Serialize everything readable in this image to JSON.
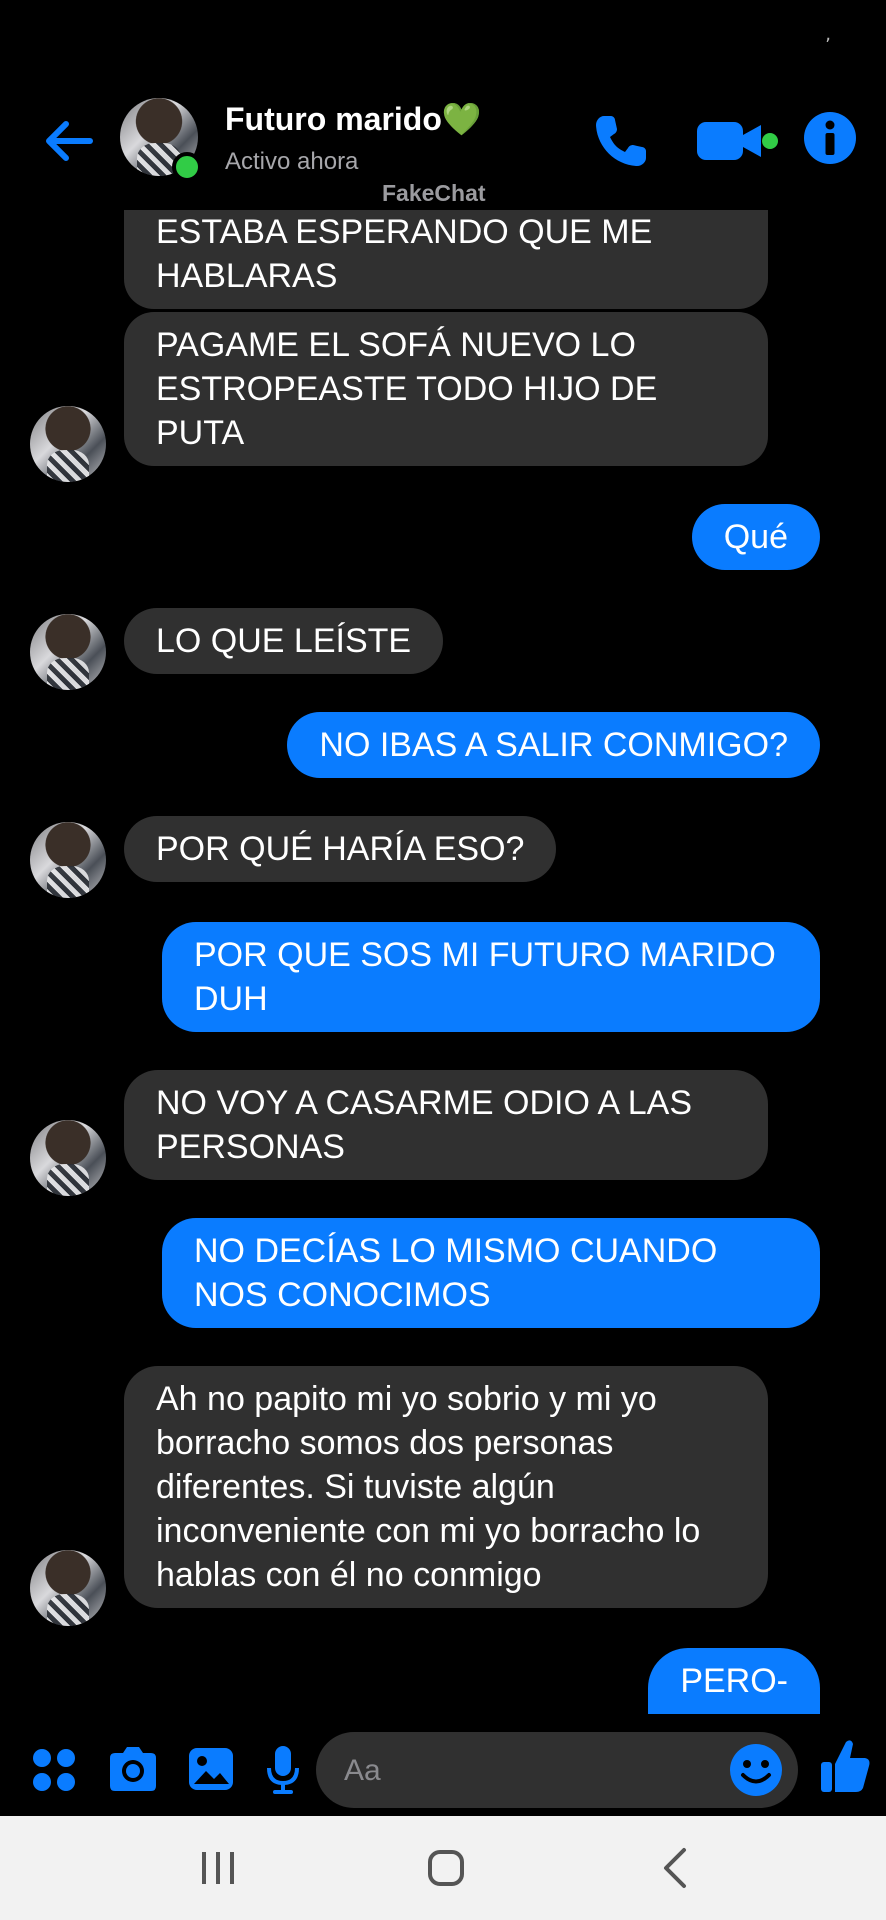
{
  "status_bar": {
    "mark": ","
  },
  "header": {
    "contact_name": "Futuro marido💚",
    "contact_status": "Activo ahora",
    "watermark": "FakeChat"
  },
  "messages": [
    {
      "side": "in",
      "text": "ESTABA ESPERANDO QUE ME HABLARAS",
      "avatar": false
    },
    {
      "side": "in",
      "text": "PAGAME EL SOFÁ NUEVO LO ESTROPEASTE TODO HIJO DE PUTA",
      "avatar": true
    },
    {
      "side": "out",
      "text": "Qué"
    },
    {
      "side": "in",
      "text": "LO QUE LEÍSTE",
      "avatar": true
    },
    {
      "side": "out",
      "text": "NO IBAS A SALIR CONMIGO?"
    },
    {
      "side": "in",
      "text": "POR QUÉ HARÍA ESO?",
      "avatar": true
    },
    {
      "side": "out",
      "text": "POR QUE SOS MI FUTURO MARIDO DUH"
    },
    {
      "side": "in",
      "text": "NO VOY A CASARME ODIO A LAS PERSONAS",
      "avatar": true
    },
    {
      "side": "out",
      "text": "NO DECÍAS LO MISMO CUANDO NOS CONOCIMOS"
    },
    {
      "side": "in",
      "text": "Ah no papito mi yo sobrio y mi yo borracho somos dos personas diferentes. Si tuviste algún inconveniente con mi yo borracho lo hablas con él no conmigo",
      "avatar": true
    },
    {
      "side": "out",
      "text": "PERO-"
    }
  ],
  "composer": {
    "placeholder": "Aa"
  },
  "colors": {
    "accent": "#0a7cff",
    "incoming_bubble": "#303030",
    "online": "#31cc46",
    "background": "#000000"
  },
  "icons": {
    "header": [
      "back-arrow-icon",
      "phone-icon",
      "video-camera-icon",
      "info-icon"
    ],
    "composer": [
      "apps-grid-icon",
      "camera-icon",
      "image-icon",
      "microphone-icon",
      "emoji-icon",
      "thumbs-up-icon"
    ],
    "navigation": [
      "recent-apps-icon",
      "home-icon",
      "back-icon"
    ]
  }
}
